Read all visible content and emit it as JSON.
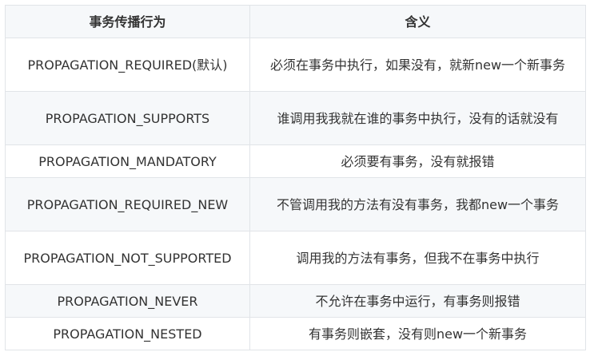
{
  "table": {
    "headers": [
      "事务传播行为",
      "含义"
    ],
    "rows": [
      {
        "behavior": "PROPAGATION_REQUIRED(默认)",
        "meaning": "必须在事务中执行，如果没有，就新new一个新事务"
      },
      {
        "behavior": "PROPAGATION_SUPPORTS",
        "meaning": "谁调用我我就在谁的事务中执行，没有的话就没有"
      },
      {
        "behavior": "PROPAGATION_MANDATORY",
        "meaning": "必须要有事务，没有就报错"
      },
      {
        "behavior": "PROPAGATION_REQUIRED_NEW",
        "meaning": "不管调用我的方法有没有事务，我都new一个事务"
      },
      {
        "behavior": "PROPAGATION_NOT_SUPPORTED",
        "meaning": "调用我的方法有事务，但我不在事务中执行"
      },
      {
        "behavior": "PROPAGATION_NEVER",
        "meaning": "不允许在事务中运行，有事务则报错"
      },
      {
        "behavior": "PROPAGATION_NESTED",
        "meaning": "有事务则嵌套，没有则new一个新事务"
      }
    ]
  },
  "colors": {
    "header_bg": "#f6f8fa",
    "stripe_bg": "#f6f8fa",
    "border": "#e1e4e8",
    "text": "#333333"
  }
}
